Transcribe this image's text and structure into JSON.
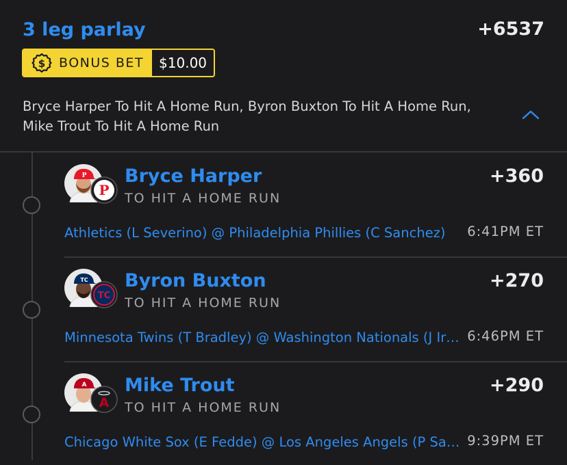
{
  "parlay": {
    "title": "3 leg parlay",
    "odds": "+6537",
    "bonus": {
      "label": "BONUS BET",
      "amount": "$10.00",
      "icon": "dollar-badge-icon"
    },
    "summary": "Bryce Harper To Hit A Home Run, Byron Buxton To Hit A Home Run, Mike Trout To Hit A Home Run",
    "expand_icon": "chevron-up-icon"
  },
  "legs": [
    {
      "player": "Bryce Harper",
      "market": "TO HIT A HOME RUN",
      "odds": "+360",
      "matchup": "Athletics (L Severino) @ Philadelphia Phillies (C Sanchez)",
      "time": "6:41PM ET",
      "team_logo": "phillies-logo",
      "team_letter": "P"
    },
    {
      "player": "Byron Buxton",
      "market": "TO HIT A HOME RUN",
      "odds": "+270",
      "matchup": "Minnesota Twins (T Bradley) @ Washington Nationals (J Irvin)",
      "time": "6:46PM ET",
      "team_logo": "twins-logo",
      "team_letter": "TC"
    },
    {
      "player": "Mike Trout",
      "market": "TO HIT A HOME RUN",
      "odds": "+290",
      "matchup": "Chicago White Sox (E Fedde) @ Los Angeles Angels (P Sandoval)",
      "time": "9:39PM ET",
      "team_logo": "angels-logo",
      "team_letter": "A"
    }
  ],
  "colors": {
    "background": "#1b1b1d",
    "accent_blue": "#2f8cf0",
    "bonus_yellow": "#f4d432",
    "phillies_red": "#e81828",
    "twins_navy": "#002b5c",
    "angels_red": "#ba0021"
  }
}
